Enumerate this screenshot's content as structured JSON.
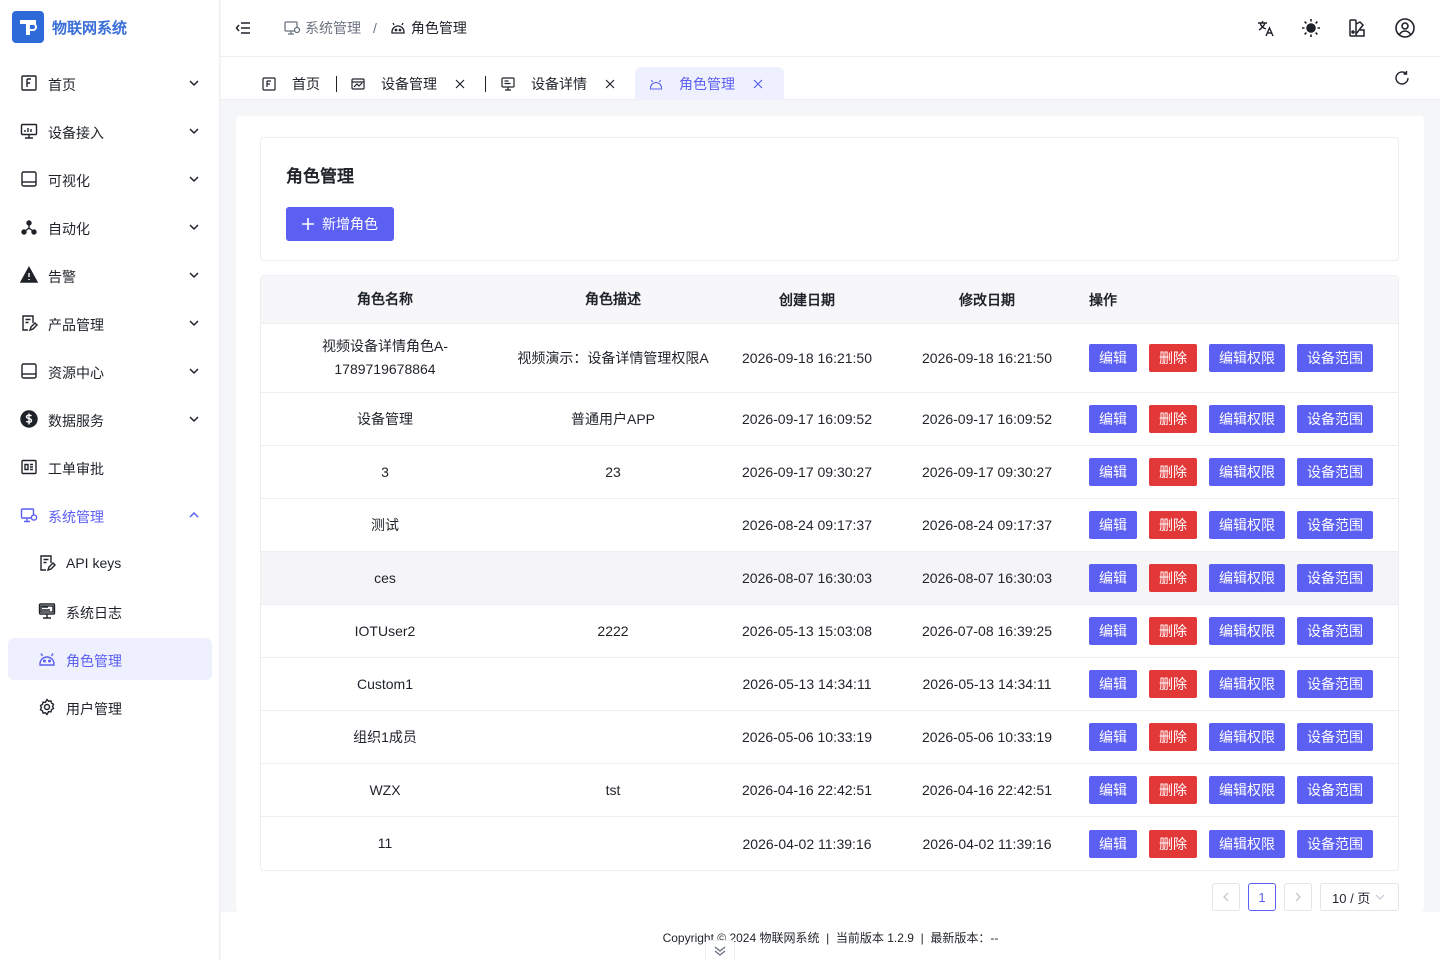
{
  "app": {
    "title": "物联网系统"
  },
  "sidebar": {
    "items": [
      {
        "label": "首页",
        "icon": "home-icon"
      },
      {
        "label": "设备接入",
        "icon": "monitor-icon"
      },
      {
        "label": "可视化",
        "icon": "screen-icon"
      },
      {
        "label": "自动化",
        "icon": "flow-icon"
      },
      {
        "label": "告警",
        "icon": "warning-icon"
      },
      {
        "label": "产品管理",
        "icon": "document-edit-icon"
      },
      {
        "label": "资源中心",
        "icon": "screen-icon"
      },
      {
        "label": "数据服务",
        "icon": "dollar-circle-icon"
      },
      {
        "label": "工单审批",
        "icon": "approval-icon"
      },
      {
        "label": "系统管理",
        "icon": "system-settings-icon"
      }
    ],
    "sub_items": [
      {
        "label": "API keys",
        "icon": "document-edit-icon"
      },
      {
        "label": "系统日志",
        "icon": "log-icon"
      },
      {
        "label": "角色管理",
        "icon": "robot-icon"
      },
      {
        "label": "用户管理",
        "icon": "gear-icon"
      }
    ]
  },
  "header": {
    "breadcrumb": [
      "系统管理",
      "角色管理"
    ],
    "separator": "/"
  },
  "tabs": [
    {
      "label": "首页"
    },
    {
      "label": "设备管理",
      "close": "X"
    },
    {
      "label": "设备详情",
      "close": "X"
    },
    {
      "label": "角色管理",
      "close": "X"
    }
  ],
  "page": {
    "title": "角色管理",
    "add_button": "新增角色"
  },
  "table": {
    "columns": [
      "角色名称",
      "角色描述",
      "创建日期",
      "修改日期",
      "操作"
    ],
    "actions": [
      "编辑",
      "删除",
      "编辑权限",
      "设备范围"
    ],
    "rows": [
      {
        "name": "视频设备详情角色A-1789719678864",
        "desc": "视频演示：设备详情管理权限A",
        "created": "2026-09-18 16:21:50",
        "modified": "2026-09-18 16:21:50"
      },
      {
        "name": "设备管理",
        "desc": "普通用户APP",
        "created": "2026-09-17 16:09:52",
        "modified": "2026-09-17 16:09:52"
      },
      {
        "name": "3",
        "desc": "23",
        "created": "2026-09-17 09:30:27",
        "modified": "2026-09-17 09:30:27"
      },
      {
        "name": "测试",
        "desc": "",
        "created": "2026-08-24 09:17:37",
        "modified": "2026-08-24 09:17:37"
      },
      {
        "name": "ces",
        "desc": "",
        "created": "2026-08-07 16:30:03",
        "modified": "2026-08-07 16:30:03"
      },
      {
        "name": "IOTUser2",
        "desc": "2222",
        "created": "2026-05-13 15:03:08",
        "modified": "2026-07-08 16:39:25"
      },
      {
        "name": "Custom1",
        "desc": "",
        "created": "2026-05-13 14:34:11",
        "modified": "2026-05-13 14:34:11"
      },
      {
        "name": "组织1成员",
        "desc": "",
        "created": "2026-05-06 10:33:19",
        "modified": "2026-05-06 10:33:19"
      },
      {
        "name": "WZX",
        "desc": "tst",
        "created": "2026-04-16 22:42:51",
        "modified": "2026-04-16 22:42:51"
      },
      {
        "name": "11",
        "desc": "",
        "created": "2026-04-02 11:39:16",
        "modified": "2026-04-02 11:39:16"
      }
    ]
  },
  "pagination": {
    "current_page": "1",
    "page_size": "10 / 页"
  },
  "footer": {
    "text": "Copyright © 2024 物联网系统  |  当前版本 1.2.9  |  最新版本：--"
  },
  "colors": {
    "primary": "#5b5ff2",
    "danger": "#e23838",
    "brand": "#2e6ad8"
  }
}
